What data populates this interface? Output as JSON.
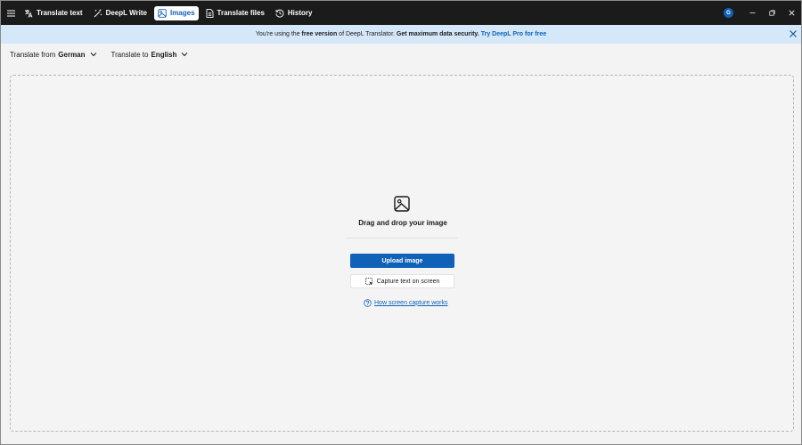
{
  "nav": {
    "items": [
      {
        "label": "Translate text",
        "icon": "translate-icon"
      },
      {
        "label": "DeepL Write",
        "icon": "magic-wand-icon"
      },
      {
        "label": "Images",
        "icon": "image-icon",
        "active": true
      },
      {
        "label": "Translate files",
        "icon": "document-icon"
      },
      {
        "label": "History",
        "icon": "history-icon"
      }
    ]
  },
  "account": {
    "initial": "G"
  },
  "banner": {
    "text_pre": "You're using the ",
    "text_bold1": "free version",
    "text_mid": " of DeepL Translator. ",
    "text_bold2": "Get maximum data security.",
    "link": "Try DeepL Pro for free"
  },
  "language": {
    "from_label": "Translate from",
    "from_value": "German",
    "to_label": "Translate to",
    "to_value": "English"
  },
  "dropzone": {
    "title": "Drag and drop your image",
    "upload_label": "Upload image",
    "capture_label": "Capture text on screen",
    "help_label": "How screen capture works"
  },
  "colors": {
    "accent": "#0f62b8",
    "topbar": "#1b1b1b",
    "banner": "#d4e8f9"
  }
}
